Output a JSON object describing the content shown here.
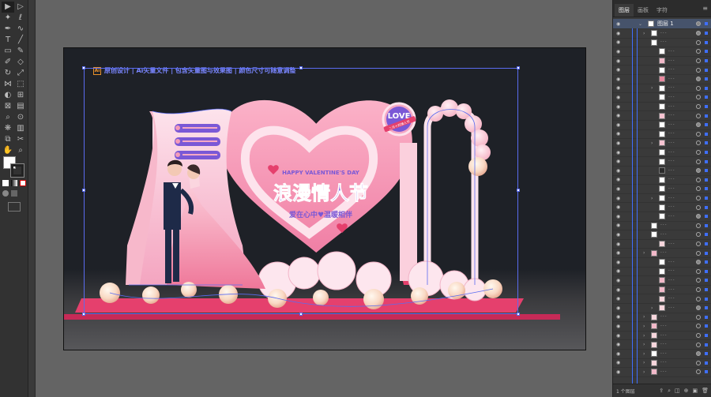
{
  "toolbar": {
    "tools": [
      {
        "name": "selection-tool",
        "glyph": "▶"
      },
      {
        "name": "direct-selection-tool",
        "glyph": "▷"
      },
      {
        "name": "magic-wand-tool",
        "glyph": "✦"
      },
      {
        "name": "lasso-tool",
        "glyph": "ℓ"
      },
      {
        "name": "pen-tool",
        "glyph": "✒"
      },
      {
        "name": "curvature-tool",
        "glyph": "∿"
      },
      {
        "name": "type-tool",
        "glyph": "T"
      },
      {
        "name": "line-tool",
        "glyph": "╱"
      },
      {
        "name": "rectangle-tool",
        "glyph": "▭"
      },
      {
        "name": "paintbrush-tool",
        "glyph": "✎"
      },
      {
        "name": "shaper-tool",
        "glyph": "✐"
      },
      {
        "name": "eraser-tool",
        "glyph": "◇"
      },
      {
        "name": "rotate-tool",
        "glyph": "↻"
      },
      {
        "name": "scale-tool",
        "glyph": "⤢"
      },
      {
        "name": "width-tool",
        "glyph": "⋈"
      },
      {
        "name": "free-transform-tool",
        "glyph": "⬚"
      },
      {
        "name": "shape-builder-tool",
        "glyph": "◐"
      },
      {
        "name": "perspective-tool",
        "glyph": "⊞"
      },
      {
        "name": "mesh-tool",
        "glyph": "⊠"
      },
      {
        "name": "gradient-tool",
        "glyph": "▤"
      },
      {
        "name": "eyedropper-tool",
        "glyph": "⌕"
      },
      {
        "name": "blend-tool",
        "glyph": "⊙"
      },
      {
        "name": "symbol-sprayer-tool",
        "glyph": "❋"
      },
      {
        "name": "column-graph-tool",
        "glyph": "▥"
      },
      {
        "name": "artboard-tool",
        "glyph": "⧉"
      },
      {
        "name": "slice-tool",
        "glyph": "✂"
      },
      {
        "name": "hand-tool",
        "glyph": "✋"
      },
      {
        "name": "zoom-tool",
        "glyph": "⌕"
      }
    ],
    "help_glyph": "?"
  },
  "canvas": {
    "header": {
      "ai_badge": "Ai",
      "text": "原创设计 | Ai矢量文件 | 包含矢量图与效果图 | 颜色尺寸可随意调整"
    },
    "design": {
      "love_badge": "LOVE",
      "love_ribbon": "二月十四情人节",
      "happy_text": "HAPPY VALENTINE'S DAY",
      "main_title": "浪漫情人节",
      "sub_title": "爱在心中♥温暖相伴",
      "colors": {
        "pink": "#f59bb8",
        "light_pink": "#fbd0dd",
        "deep_pink": "#e5406d",
        "navy": "#1e2a48",
        "purple": "#7a58d6",
        "background": "#1e2127"
      }
    }
  },
  "layers_panel": {
    "tabs": [
      "图层",
      "画板",
      "字符"
    ],
    "top_layer_name": "图层 1",
    "footer_text": "1 个图层",
    "footer_icons": [
      "export-icon",
      "search-icon",
      "clip-icon",
      "new-sublayer-icon",
      "new-layer-icon",
      "trash-icon"
    ]
  }
}
